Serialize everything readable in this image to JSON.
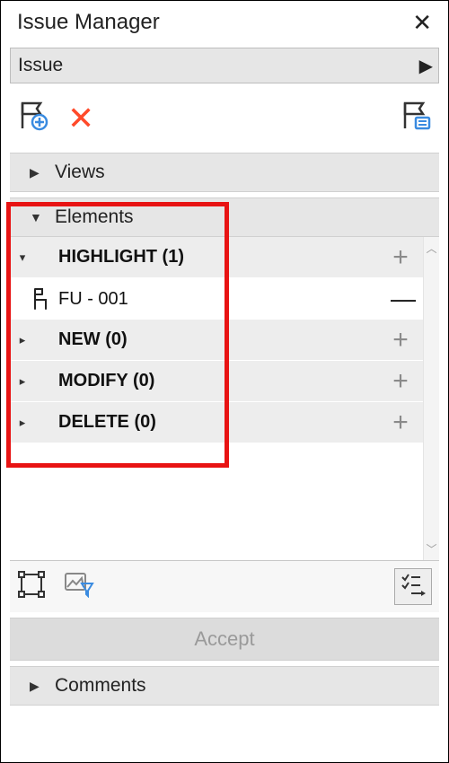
{
  "titlebar": {
    "title": "Issue Manager"
  },
  "dropdown": {
    "label": "Issue"
  },
  "sections": {
    "views": {
      "label": "Views",
      "expanded": false
    },
    "elements": {
      "label": "Elements",
      "expanded": true,
      "groups": [
        {
          "label": "HIGHLIGHT (1)",
          "action": "+"
        },
        {
          "label": "NEW (0)",
          "action": "+"
        },
        {
          "label": "MODIFY (0)",
          "action": "+"
        },
        {
          "label": "DELETE (0)",
          "action": "+"
        }
      ],
      "item": {
        "label": "FU - 001"
      }
    },
    "comments": {
      "label": "Comments",
      "expanded": false
    }
  },
  "buttons": {
    "accept": "Accept"
  }
}
